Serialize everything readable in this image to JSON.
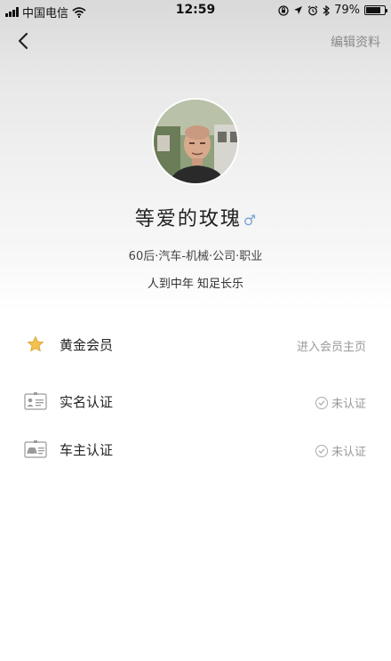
{
  "status_bar": {
    "carrier": "中国电信",
    "time": "12:59",
    "battery": "79%",
    "battery_level": 0.79
  },
  "nav": {
    "edit_label": "编辑资料"
  },
  "profile": {
    "name": "等爱的玫瑰",
    "gender_symbol": "♂",
    "tags": "60后·汽车-机械·公司·职业",
    "bio": "人到中年 知足长乐"
  },
  "list": [
    {
      "label": "黄金会员",
      "right": "进入会员主页",
      "icon": "gold-star-icon"
    },
    {
      "label": "实名认证",
      "right": "未认证",
      "icon": "id-card-icon"
    },
    {
      "label": "车主认证",
      "right": "未认证",
      "icon": "car-card-icon"
    }
  ],
  "colors": {
    "gender": "#7aa3d6",
    "star": "#f2c14e",
    "muted_text": "#999999"
  }
}
